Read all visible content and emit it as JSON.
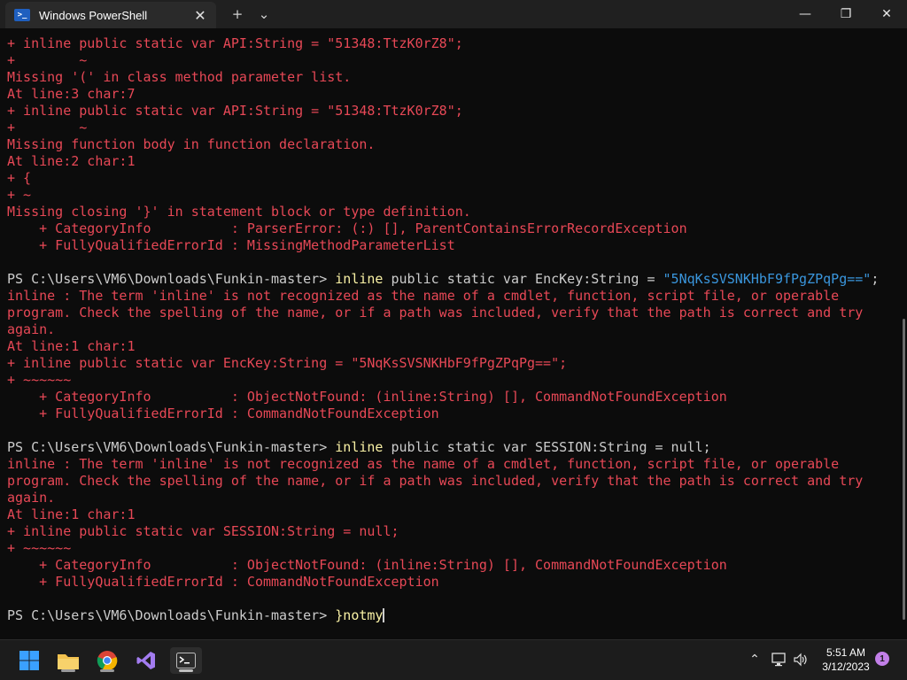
{
  "window": {
    "tab_title": "Windows PowerShell",
    "tab_icon_glyph": ">_",
    "close_tab_glyph": "✕",
    "new_tab_glyph": "+",
    "dropdown_glyph": "⌄",
    "minimize_glyph": "—",
    "maximize_glyph": "❐",
    "close_glyph": "✕"
  },
  "terminal": {
    "colors": {
      "error": "#e74856",
      "command": "#f9f1a5",
      "string": "#3a96dd",
      "text": "#cccccc"
    },
    "lines": [
      {
        "type": "err",
        "text": "+ inline public static var API:String = \"51348:TtzK0rZ8\";"
      },
      {
        "type": "err",
        "text": "+        ~"
      },
      {
        "type": "err",
        "text": "Missing '(' in class method parameter list."
      },
      {
        "type": "err",
        "text": "At line:3 char:7"
      },
      {
        "type": "err",
        "text": "+ inline public static var API:String = \"51348:TtzK0rZ8\";"
      },
      {
        "type": "err",
        "text": "+        ~"
      },
      {
        "type": "err",
        "text": "Missing function body in function declaration."
      },
      {
        "type": "err",
        "text": "At line:2 char:1"
      },
      {
        "type": "err",
        "text": "+ {"
      },
      {
        "type": "err",
        "text": "+ ~"
      },
      {
        "type": "err",
        "text": "Missing closing '}' in statement block or type definition."
      },
      {
        "type": "err",
        "text": "    + CategoryInfo          : ParserError: (:) [], ParentContainsErrorRecordException"
      },
      {
        "type": "err",
        "text": "    + FullyQualifiedErrorId : MissingMethodParameterList"
      },
      {
        "type": "blank",
        "text": ""
      },
      {
        "type": "prompt",
        "prompt": "PS C:\\Users\\VM6\\Downloads\\Funkin-master> ",
        "cmd": "inline",
        "args": " public static var EncKey:String = ",
        "str": "\"5NqKsSVSNKHbF9fPgZPqPg==\"",
        "tail": ";"
      },
      {
        "type": "err",
        "text": "inline : The term 'inline' is not recognized as the name of a cmdlet, function, script file, or operable"
      },
      {
        "type": "err",
        "text": "program. Check the spelling of the name, or if a path was included, verify that the path is correct and try"
      },
      {
        "type": "err",
        "text": "again."
      },
      {
        "type": "err",
        "text": "At line:1 char:1"
      },
      {
        "type": "err",
        "text": "+ inline public static var EncKey:String = \"5NqKsSVSNKHbF9fPgZPqPg==\";"
      },
      {
        "type": "err",
        "text": "+ ~~~~~~"
      },
      {
        "type": "err",
        "text": "    + CategoryInfo          : ObjectNotFound: (inline:String) [], CommandNotFoundException"
      },
      {
        "type": "err",
        "text": "    + FullyQualifiedErrorId : CommandNotFoundException"
      },
      {
        "type": "blank",
        "text": ""
      },
      {
        "type": "prompt",
        "prompt": "PS C:\\Users\\VM6\\Downloads\\Funkin-master> ",
        "cmd": "inline",
        "args": " public static var SESSION:String = null;",
        "str": "",
        "tail": ""
      },
      {
        "type": "err",
        "text": "inline : The term 'inline' is not recognized as the name of a cmdlet, function, script file, or operable"
      },
      {
        "type": "err",
        "text": "program. Check the spelling of the name, or if a path was included, verify that the path is correct and try"
      },
      {
        "type": "err",
        "text": "again."
      },
      {
        "type": "err",
        "text": "At line:1 char:1"
      },
      {
        "type": "err",
        "text": "+ inline public static var SESSION:String = null;"
      },
      {
        "type": "err",
        "text": "+ ~~~~~~"
      },
      {
        "type": "err",
        "text": "    + CategoryInfo          : ObjectNotFound: (inline:String) [], CommandNotFoundException"
      },
      {
        "type": "err",
        "text": "    + FullyQualifiedErrorId : CommandNotFoundException"
      },
      {
        "type": "blank",
        "text": ""
      },
      {
        "type": "prompt",
        "prompt": "PS C:\\Users\\VM6\\Downloads\\Funkin-master> ",
        "cmd": "}notmy",
        "args": "",
        "str": "",
        "tail": "",
        "cursor": true
      }
    ]
  },
  "taskbar": {
    "apps": [
      {
        "name": "start",
        "glyph": "⊞",
        "color": "#3aa0ff"
      },
      {
        "name": "file-explorer",
        "glyph": "▬",
        "color": "#f2c14e"
      },
      {
        "name": "chrome",
        "glyph": "◉",
        "color": "#34a853"
      },
      {
        "name": "visual-studio",
        "glyph": "∞",
        "color": "#a37cf0"
      },
      {
        "name": "terminal",
        "glyph": ">_",
        "color": "#e0e0e0"
      }
    ],
    "tray": {
      "chevron": "⌃",
      "network": "▭",
      "volume": "🔈"
    },
    "time": "5:51 AM",
    "date": "3/12/2023",
    "notification_count": "1"
  }
}
